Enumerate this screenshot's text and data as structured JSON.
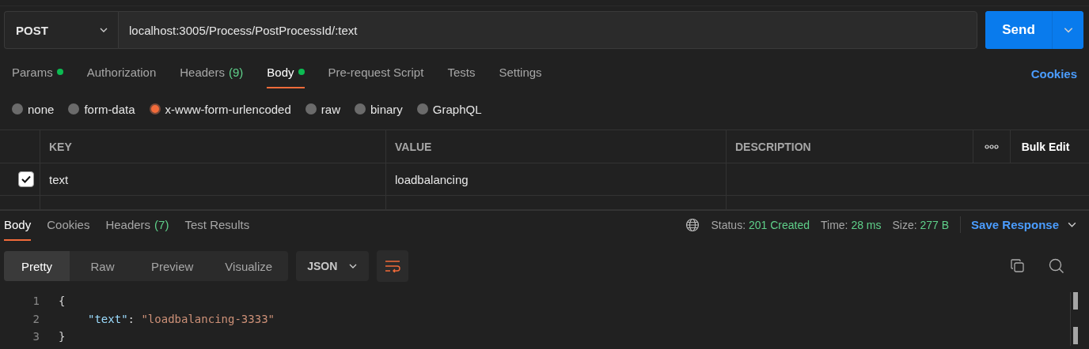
{
  "request": {
    "method": "POST",
    "url": "localhost:3005/Process/PostProcessId/:text",
    "send": "Send"
  },
  "request_tabs": [
    {
      "label": "Params",
      "indicator": true,
      "selected": false
    },
    {
      "label": "Authorization",
      "indicator": false,
      "selected": false
    },
    {
      "label": "Headers",
      "count": "(9)",
      "indicator": false,
      "selected": false
    },
    {
      "label": "Body",
      "indicator": true,
      "selected": true
    },
    {
      "label": "Pre-request Script",
      "indicator": false,
      "selected": false
    },
    {
      "label": "Tests",
      "indicator": false,
      "selected": false
    },
    {
      "label": "Settings",
      "indicator": false,
      "selected": false
    }
  ],
  "cookies_link": "Cookies",
  "body_types": [
    {
      "label": "none",
      "selected": false
    },
    {
      "label": "form-data",
      "selected": false
    },
    {
      "label": "x-www-form-urlencoded",
      "selected": true
    },
    {
      "label": "raw",
      "selected": false
    },
    {
      "label": "binary",
      "selected": false
    },
    {
      "label": "GraphQL",
      "selected": false
    }
  ],
  "table": {
    "columns": [
      "KEY",
      "VALUE",
      "DESCRIPTION"
    ],
    "bulk_edit": "Bulk Edit",
    "rows": [
      {
        "checked": true,
        "key": "text",
        "value": "loadbalancing"
      }
    ]
  },
  "response": {
    "tabs": [
      {
        "label": "Body",
        "selected": true
      },
      {
        "label": "Cookies",
        "selected": false
      },
      {
        "label": "Headers",
        "count": "(7)",
        "selected": false
      },
      {
        "label": "Test Results",
        "selected": false
      }
    ],
    "stats": [
      {
        "label": "Status:",
        "value": "201 Created"
      },
      {
        "label": "Time:",
        "value": "28 ms"
      },
      {
        "label": "Size:",
        "value": "277 B"
      }
    ],
    "save": "Save Response",
    "view_tabs": [
      {
        "label": "Pretty",
        "selected": true
      },
      {
        "label": "Raw",
        "selected": false
      },
      {
        "label": "Preview",
        "selected": false
      },
      {
        "label": "Visualize",
        "selected": false
      }
    ],
    "format": "JSON",
    "code": [
      {
        "number": "1",
        "tokens": [
          {
            "kind": "punct",
            "text": "{"
          }
        ]
      },
      {
        "number": "2",
        "tokens": [
          {
            "kind": "key",
            "text": "\"text\""
          },
          {
            "kind": "punct",
            "text": ": "
          },
          {
            "kind": "string",
            "text": "\"loadbalancing-3333\""
          }
        ]
      },
      {
        "number": "3",
        "tokens": [
          {
            "kind": "punct",
            "text": "}"
          }
        ]
      }
    ]
  }
}
